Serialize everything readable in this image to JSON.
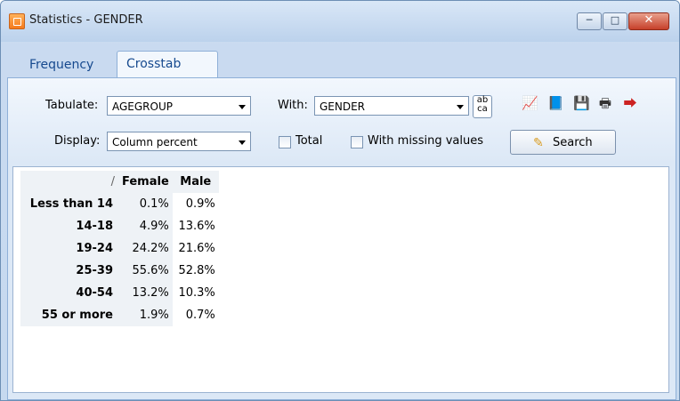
{
  "window": {
    "title": "Statistics - GENDER",
    "controls": {
      "minimize": "─",
      "maximize": "□",
      "close": "✕"
    }
  },
  "tabs": [
    {
      "label": "Frequency",
      "active": false
    },
    {
      "label": "Crosstab",
      "active": true
    }
  ],
  "form": {
    "tabulate_label": "Tabulate:",
    "tabulate_value": "AGEGROUP",
    "display_label": "Display:",
    "display_value": "Column percent",
    "with_label": "With:",
    "with_value": "GENDER",
    "total_label": "Total",
    "total_checked": false,
    "missing_label": "With missing values",
    "missing_checked": false,
    "search_label": "Search"
  },
  "toolbar_icons": [
    "chart-icon",
    "export-icon",
    "save-icon",
    "print-icon",
    "exit-icon"
  ],
  "table": {
    "corner": "/",
    "columns": [
      "Female",
      "Male"
    ],
    "rows": [
      {
        "label": "Less than 14",
        "values": [
          "0.1%",
          "0.9%"
        ]
      },
      {
        "label": "14-18",
        "values": [
          "4.9%",
          "13.6%"
        ]
      },
      {
        "label": "19-24",
        "values": [
          "24.2%",
          "21.6%"
        ]
      },
      {
        "label": "25-39",
        "values": [
          "55.6%",
          "52.8%"
        ]
      },
      {
        "label": "40-54",
        "values": [
          "13.2%",
          "10.3%"
        ]
      },
      {
        "label": "55 or more",
        "values": [
          "1.9%",
          "0.7%"
        ]
      }
    ]
  }
}
